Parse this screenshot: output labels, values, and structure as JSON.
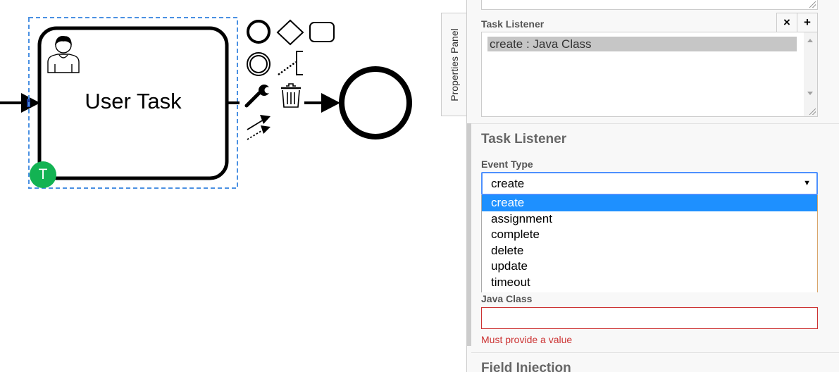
{
  "canvas": {
    "task_label": "User Task",
    "task_badge": "T",
    "palette_icons": [
      "start-event-icon",
      "gateway-icon",
      "task-icon",
      "intermediate-event-icon",
      "text-annotation-icon",
      "change-type-icon",
      "delete-icon",
      "connect-icon"
    ]
  },
  "panel_toggle": {
    "label": "Properties Panel"
  },
  "panel": {
    "listeners_label": "Task Listener",
    "remove_button": "×",
    "add_button": "+",
    "listeners": [
      "create : Java Class"
    ],
    "group_title": "Task Listener",
    "event_type": {
      "label": "Event Type",
      "value": "create",
      "arrow": "▼",
      "options": [
        "create",
        "assignment",
        "complete",
        "delete",
        "update",
        "timeout"
      ]
    },
    "java_class": {
      "label": "Java Class",
      "value": "",
      "error": "Must provide a value"
    },
    "next_group_title": "Field Injection"
  },
  "colors": {
    "selection": "#4a90e2",
    "badge": "#13b353",
    "focus": "#4d90fe",
    "option_selected": "#1e90ff",
    "error": "#cc3333"
  }
}
